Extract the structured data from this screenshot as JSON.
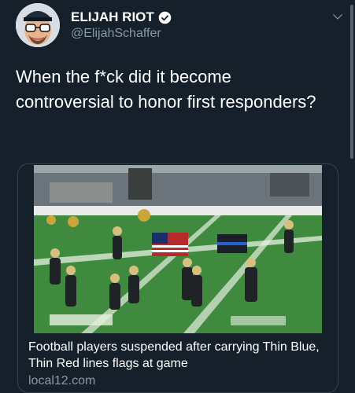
{
  "tweet": {
    "display_name": "ELIJAH RIOT",
    "handle": "@ElijahSchaffer",
    "text": "When the f*ck did it become controversial to honor first responders?"
  },
  "icons": {
    "verified": "verified-badge-icon",
    "menu": "chevron-down-icon"
  },
  "card": {
    "title": "Football players suspended after carrying Thin Blue, Thin Red lines flags at game",
    "domain": "local12.com"
  },
  "colors": {
    "background": "#15202b",
    "text_primary": "#ffffff",
    "text_secondary": "#8899a6",
    "border": "#38444d"
  }
}
